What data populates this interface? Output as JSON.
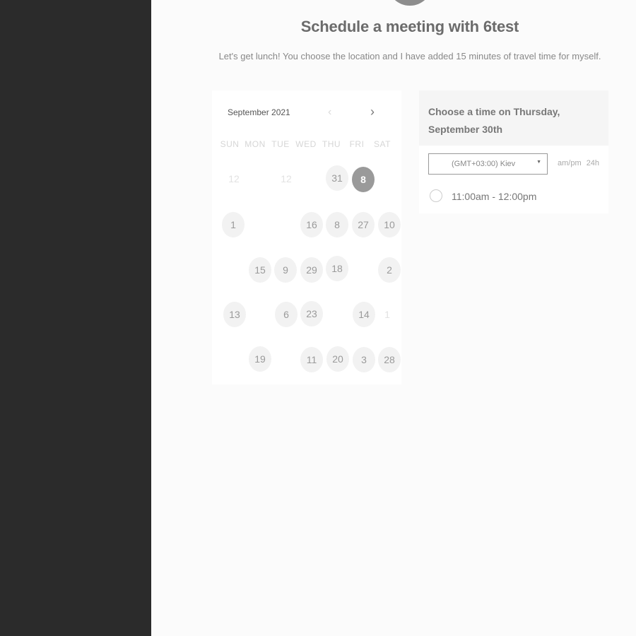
{
  "page": {
    "title": "Schedule a meeting with 6test",
    "description": "Let's get lunch! You choose the location and I have added 15 minutes of travel time for myself."
  },
  "calendar": {
    "month_label": "September 2021",
    "prev_icon": "chevron-left",
    "next_icon": "chevron-right",
    "weekdays": [
      "SUN",
      "MON",
      "TUE",
      "WED",
      "THU",
      "FRI",
      "SAT"
    ],
    "days": [
      {
        "label": "12",
        "state": "disabled"
      },
      {
        "label": "12",
        "state": "disabled"
      },
      {
        "label": "31",
        "state": "available"
      },
      {
        "label": "8",
        "state": "selected"
      },
      {
        "label": "1",
        "state": "available"
      },
      {
        "label": "16",
        "state": "available"
      },
      {
        "label": "8",
        "state": "available"
      },
      {
        "label": "27",
        "state": "available"
      },
      {
        "label": "10",
        "state": "available"
      },
      {
        "label": "15",
        "state": "available"
      },
      {
        "label": "9",
        "state": "available"
      },
      {
        "label": "29",
        "state": "available"
      },
      {
        "label": "18",
        "state": "available"
      },
      {
        "label": "2",
        "state": "available"
      },
      {
        "label": "13",
        "state": "available"
      },
      {
        "label": "6",
        "state": "available"
      },
      {
        "label": "23",
        "state": "available"
      },
      {
        "label": "14",
        "state": "available"
      },
      {
        "label": "1",
        "state": "disabled"
      },
      {
        "label": "19",
        "state": "available"
      },
      {
        "label": "11",
        "state": "available"
      },
      {
        "label": "20",
        "state": "available"
      },
      {
        "label": "3",
        "state": "available"
      },
      {
        "label": "28",
        "state": "available"
      }
    ]
  },
  "slots": {
    "heading": "Choose a time on Thursday, September 30th",
    "timezone": "(GMT+03:00) Kiev",
    "format_options": [
      "am/pm",
      "24h"
    ],
    "times": [
      "11:00am - 12:00pm"
    ]
  },
  "colors": {
    "sidebar": "#2b2b2b",
    "selected_day": "#9a9a9a"
  }
}
